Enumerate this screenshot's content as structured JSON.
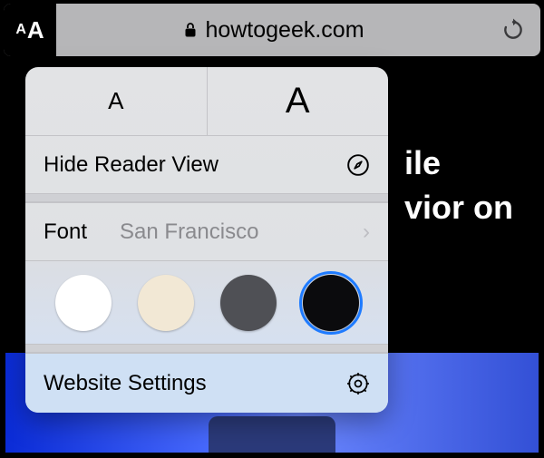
{
  "address_bar": {
    "text_size_button": "aA",
    "url": "howtogeek.com",
    "lock_icon": "lock-icon",
    "reload_icon": "reload-icon"
  },
  "page_fragment": {
    "line1": "ile",
    "line2": "vior on"
  },
  "popover": {
    "decrease_glyph": "A",
    "increase_glyph": "A",
    "hide_reader_label": "Hide Reader View",
    "compass_icon": "compass-icon",
    "font_label": "Font",
    "font_value": "San Francisco",
    "chevron_glyph": "›",
    "themes": [
      {
        "name": "white",
        "color": "#ffffff",
        "selected": false
      },
      {
        "name": "sepia",
        "color": "#f2e8d5",
        "selected": false
      },
      {
        "name": "gray",
        "color": "#4f5055",
        "selected": false
      },
      {
        "name": "black",
        "color": "#0b0b0d",
        "selected": true
      }
    ],
    "website_settings_label": "Website Settings",
    "gear_icon": "gear-icon"
  }
}
